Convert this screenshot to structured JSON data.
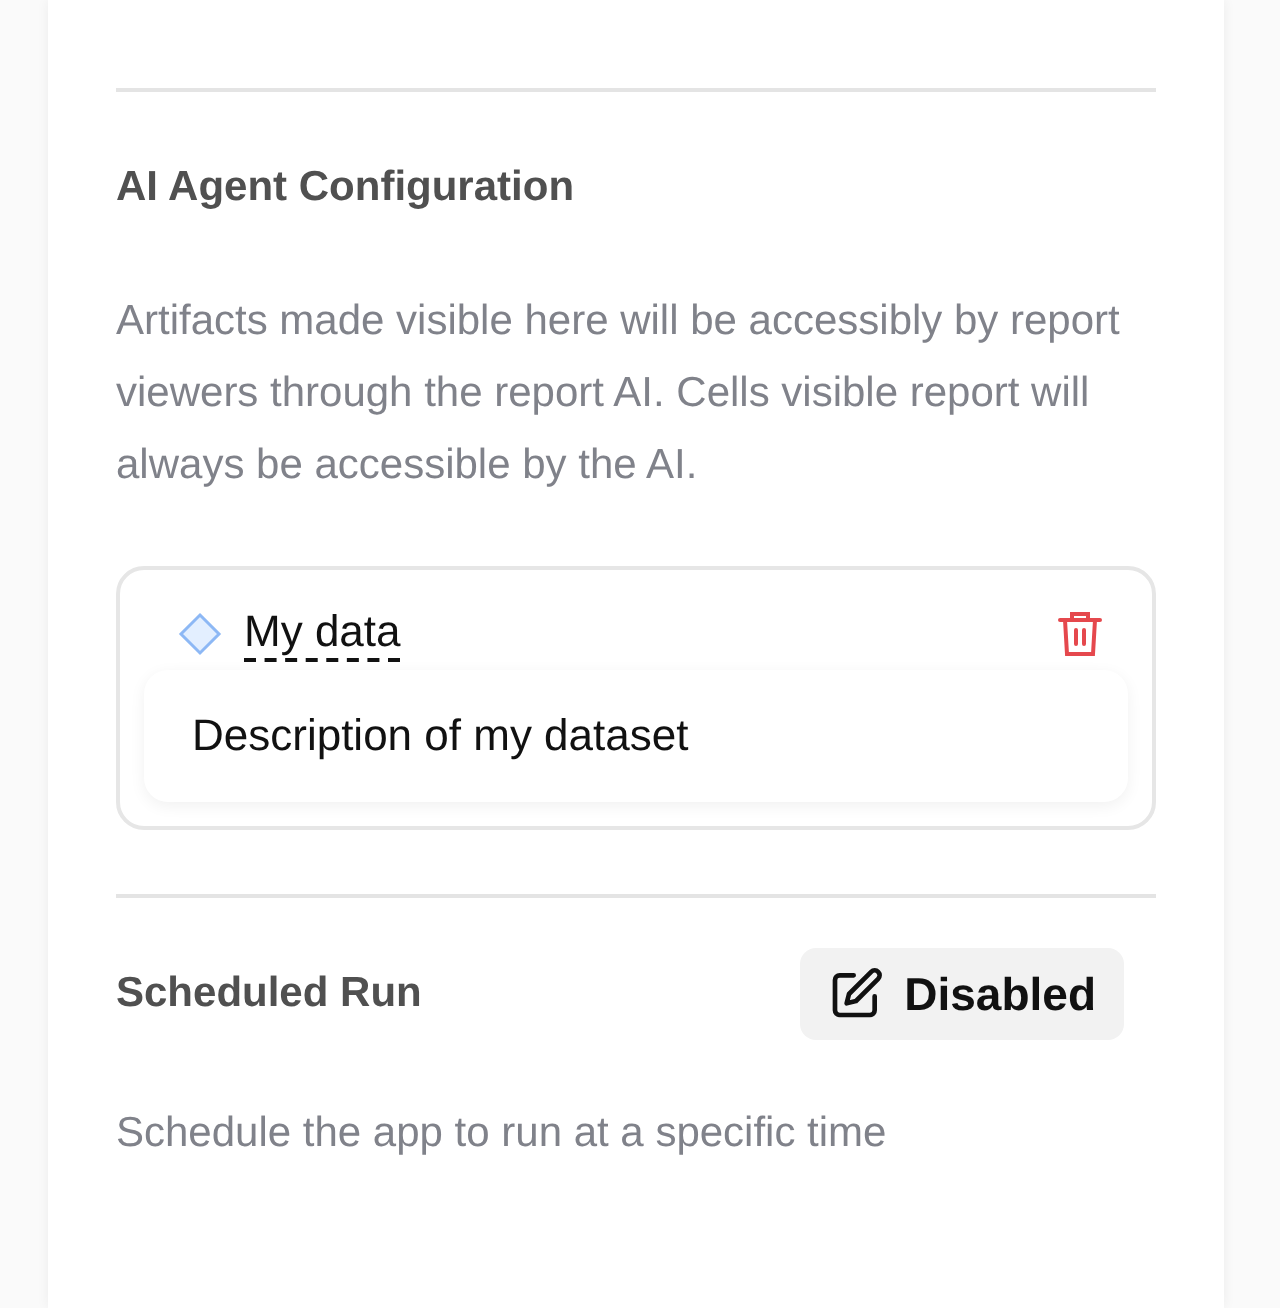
{
  "ai_agent": {
    "title": "AI Agent Configuration",
    "description": "Artifacts made visible here will be accessibly by report viewers through the report AI. Cells visible report will always be accessible by the AI.",
    "artifacts": [
      {
        "name": "My data",
        "description": "Description of my dataset"
      }
    ]
  },
  "scheduled_run": {
    "title": "Scheduled Run",
    "button": "Disabled",
    "description": "Schedule the app to run at a specific time"
  }
}
